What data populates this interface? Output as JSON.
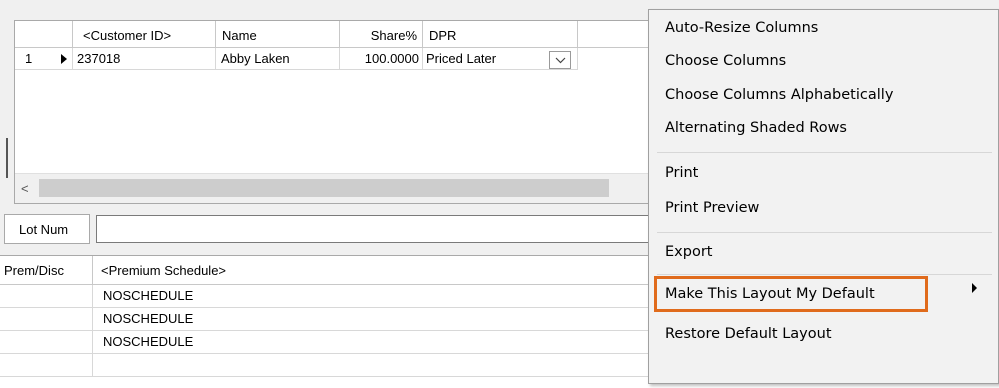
{
  "grid_top": {
    "headers": [
      "<Customer ID>",
      "Name",
      "Share%",
      "DPR"
    ],
    "row": {
      "number": "1",
      "customer_id": "237018",
      "name": "Abby Laken",
      "share": "100.0000",
      "dpr": "Priced Later"
    }
  },
  "lot": {
    "label": "Lot Num",
    "value": ""
  },
  "grid_bottom": {
    "headers": [
      "Prem/Disc",
      "<Premium Schedule>"
    ],
    "rows": [
      "NOSCHEDULE",
      "NOSCHEDULE",
      "NOSCHEDULE"
    ]
  },
  "context_menu": {
    "items": [
      "Auto-Resize Columns",
      "Choose Columns",
      "Choose Columns Alphabetically",
      "Alternating Shaded Rows",
      "Print",
      "Print Preview",
      "Export",
      "Make This Layout My Default",
      "Restore Default Layout"
    ],
    "highlight_color": "#e06b1c"
  }
}
